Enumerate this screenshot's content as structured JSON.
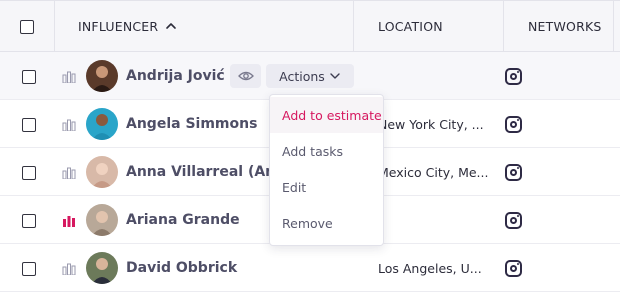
{
  "header": {
    "influencer_label": "INFLUENCER",
    "location_label": "LOCATION",
    "networks_label": "NETWORKS"
  },
  "rows": [
    {
      "name": "Andrija Jović",
      "location": "",
      "stats_color": "#9a9aae",
      "avatar_bg": "#5a3a2a"
    },
    {
      "name": "Angela Simmons",
      "location": "New York City, ...",
      "stats_color": "#9a9aae",
      "avatar_bg": "#2aa5c9"
    },
    {
      "name": "Anna Villarreal (Anina",
      "location": "Mexico City, Me...",
      "stats_color": "#9a9aae",
      "avatar_bg": "#d8b9a8"
    },
    {
      "name": "Ariana Grande",
      "location": "",
      "stats_color": "#d6185f",
      "avatar_bg": "#b8a898"
    },
    {
      "name": "David Obbrick",
      "location": "Los Angeles, U...",
      "stats_color": "#9a9aae",
      "avatar_bg": "#6c7a5a"
    }
  ],
  "row_actions": {
    "actions_label": "Actions"
  },
  "menu": {
    "items": [
      {
        "label": "Add to estimate"
      },
      {
        "label": "Add tasks"
      },
      {
        "label": "Edit"
      },
      {
        "label": "Remove"
      }
    ]
  },
  "colors": {
    "accent": "#d6185f",
    "header_bg": "#f6f6f9"
  }
}
